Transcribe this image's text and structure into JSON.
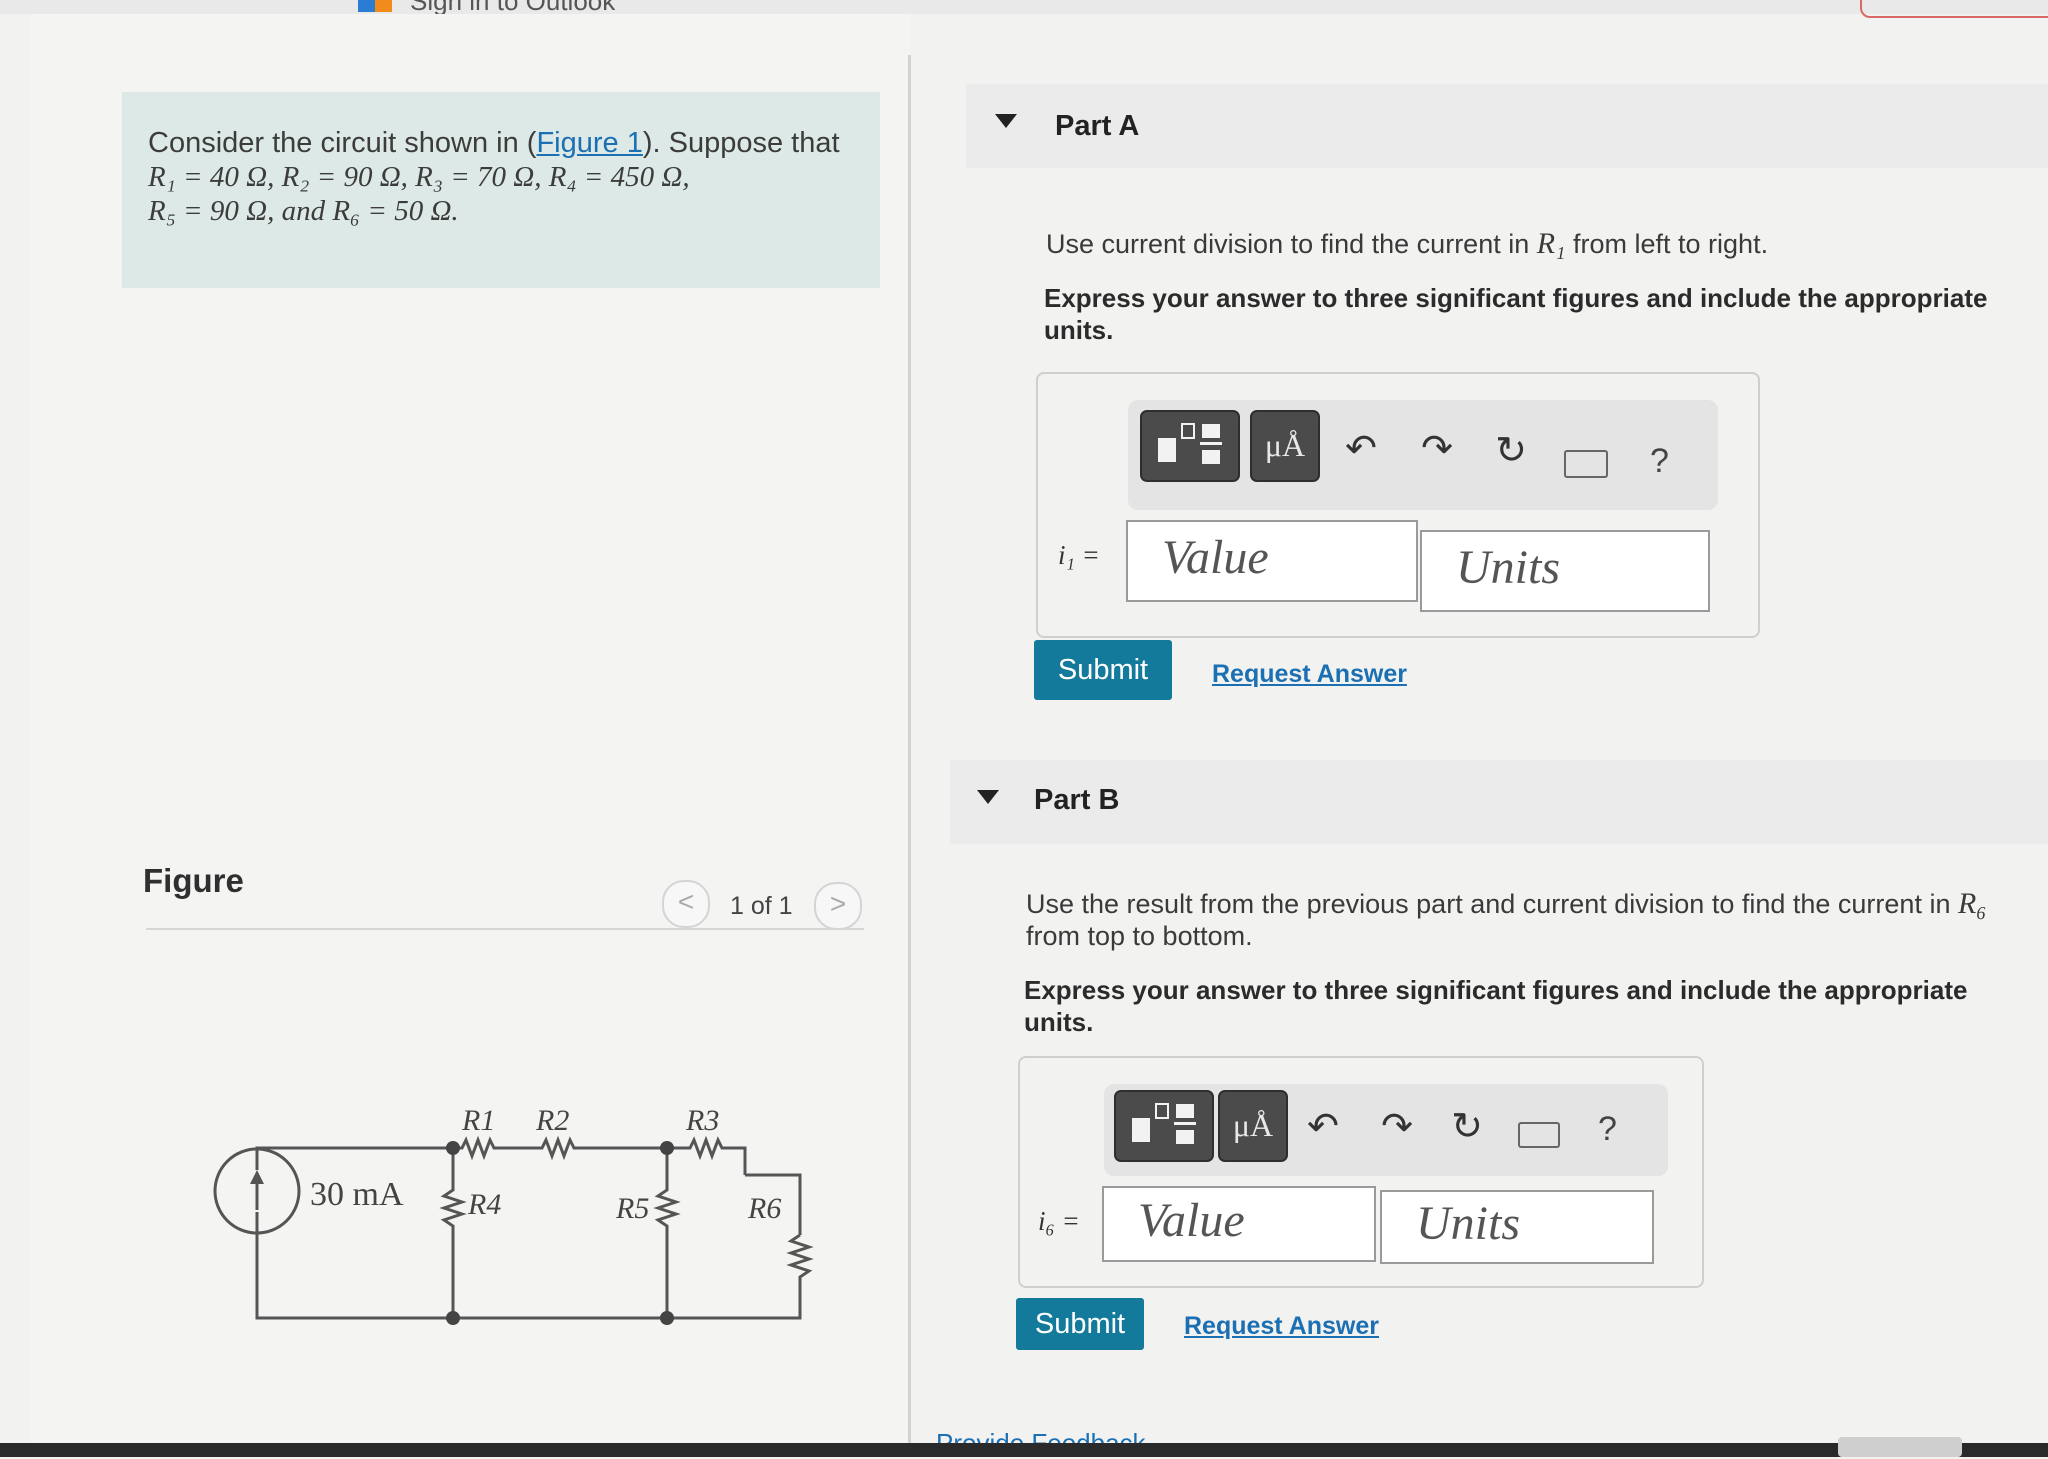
{
  "app": {
    "title": "Sign in to Outlook"
  },
  "problem": {
    "intro": "Consider the circuit shown in (",
    "figure_link": "Figure 1",
    "intro_end": "). Suppose that",
    "line2": "R₁ = 40 Ω, R₂ = 90 Ω, R₃ = 70 Ω, R₄ = 450 Ω,",
    "line3": "R₅ = 90 Ω, and R₆ = 50 Ω."
  },
  "figure": {
    "label": "Figure",
    "page": "1 of 1",
    "prev": "<",
    "next": ">",
    "source_label": "30 mA",
    "resistors": [
      "R1",
      "R2",
      "R3",
      "R4",
      "R5",
      "R6"
    ]
  },
  "parts": [
    {
      "title": "Part A",
      "instruction_pre": "Use current division to find the current in ",
      "instruction_var": "R₁",
      "instruction_post": " from left to right.",
      "express": "Express your answer to three significant figures and include the appropriate units.",
      "answer_label": "i₁ =",
      "value_placeholder": "Value",
      "units_placeholder": "Units",
      "submit": "Submit",
      "request": "Request Answer"
    },
    {
      "title": "Part B",
      "instruction_pre": "Use the result from the previous part and current division to find the current in ",
      "instruction_var": "R₆",
      "instruction_post": " from top to bottom.",
      "express": "Express your answer to three significant figures and include the appropriate units.",
      "answer_label": "i₆ =",
      "value_placeholder": "Value",
      "units_placeholder": "Units",
      "submit": "Submit",
      "request": "Request Answer"
    }
  ],
  "toolbar": {
    "mu_label": "μÅ",
    "help": "?",
    "icons": [
      "templates-icon",
      "units-icon",
      "undo-icon",
      "redo-icon",
      "reset-icon",
      "keyboard-icon",
      "help-icon"
    ]
  },
  "footer": {
    "feedback": "Provide Feedback"
  }
}
